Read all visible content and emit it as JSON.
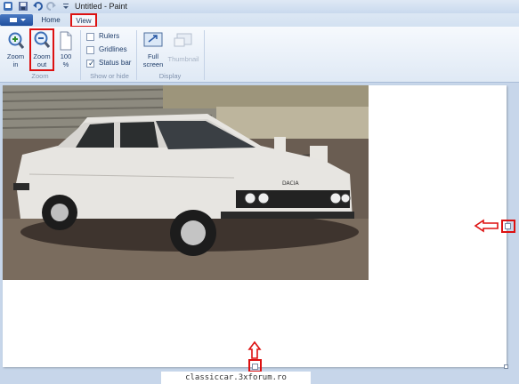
{
  "window": {
    "title": "Untitled - Paint"
  },
  "tabs": [
    {
      "label": "Home"
    },
    {
      "label": "View"
    }
  ],
  "ribbon": {
    "zoom_group": {
      "label": "Zoom",
      "zoom_in_label_1": "Zoom",
      "zoom_in_label_2": "in",
      "zoom_out_label_1": "Zoom",
      "zoom_out_label_2": "out",
      "pct_label_1": "100",
      "pct_label_2": "%"
    },
    "show_group": {
      "label": "Show or hide",
      "rulers": {
        "label": "Rulers",
        "checked": false
      },
      "gridlines": {
        "label": "Gridlines",
        "checked": false
      },
      "status_bar": {
        "label": "Status bar",
        "checked": true
      }
    },
    "display_group": {
      "label": "Display",
      "full_label_1": "Full",
      "full_label_2": "screen",
      "thumb_label": "Thumbnail"
    }
  },
  "icons": {
    "zoom_in": "zoom-in-icon",
    "zoom_out": "zoom-out-icon",
    "hundred": "page-icon",
    "fullscreen": "fullscreen-icon",
    "thumbnail": "thumbnail-icon"
  },
  "photo": {
    "plate_text": "DACIA"
  },
  "watermark": "classiccar.3xforum.ro",
  "colors": {
    "highlight": "#dd1111",
    "accent": "#1f4f9e"
  }
}
